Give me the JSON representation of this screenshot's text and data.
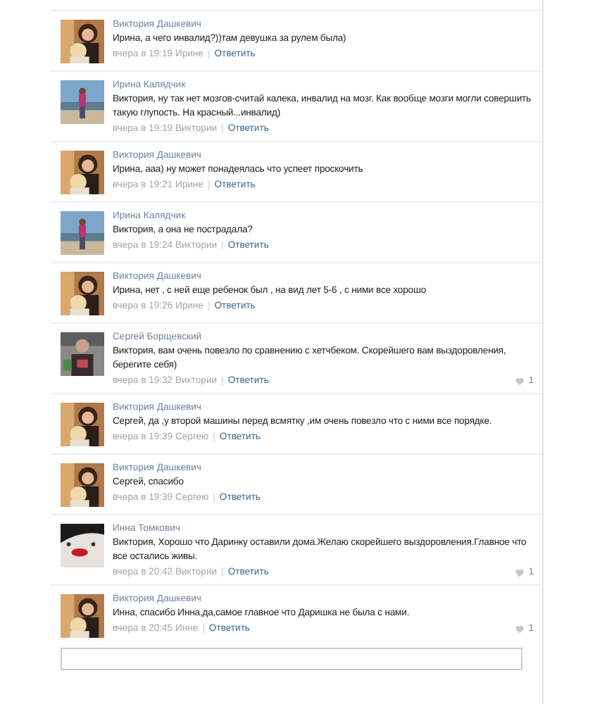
{
  "comments": [
    {
      "author": "Виктория Дашкевич",
      "text": "Ирина, а чего инвалид?))там девушка за рулем была)",
      "date": "вчера в 19:19 Ирине",
      "sep": "|",
      "reply": "Ответить"
    },
    {
      "author": "Ирина Калядчик",
      "text": "Виктория, ну так нет мозгов-считай калека, инвалид на мозг. Как вообще мозги могли совершить такую глупость. На красный...инвалид)",
      "date": "вчера в 19:19 Виктории",
      "sep": "|",
      "reply": "Ответить"
    },
    {
      "author": "Виктория Дашкевич",
      "text": "Ирина, ааа) ну может понадеялась что успеет проскочить",
      "date": "вчера в 19:21 Ирине",
      "sep": "|",
      "reply": "Ответить"
    },
    {
      "author": "Ирина Калядчик",
      "text": "Виктория, а она не пострадала?",
      "date": "вчера в 19:24 Виктории",
      "sep": "|",
      "reply": "Ответить"
    },
    {
      "author": "Виктория Дашкевич",
      "text": "Ирина, нет , с ней еще ребенок был , на вид лет 5-6 , с ними все хорошо",
      "date": "вчера в 19:26 Ирине",
      "sep": "|",
      "reply": "Ответить"
    },
    {
      "author": "Сергей Борщевский",
      "text": "Виктория, вам очень повезло по сравнению с хетчбеком. Скорейшего вам выздоровления, берегите себя)",
      "date": "вчера в 19:32 Виктории",
      "sep": "|",
      "reply": "Ответить",
      "likes": "1"
    },
    {
      "author": "Виктория Дашкевич",
      "text": "Сергей, да ,у второй машины перед всмятку ,им очень повезло что с ними все порядке.",
      "date": "вчера в 19:39 Сергею",
      "sep": "|",
      "reply": "Ответить"
    },
    {
      "author": "Виктория Дашкевич",
      "text": "Сергей, спасибо",
      "date": "вчера в 19:39 Сергею",
      "sep": "|",
      "reply": "Ответить"
    },
    {
      "author": "Инна Томкович",
      "text": "Виктория, Хорошо что Даринку оставили дома.Желаю скорейшего выздоровления.Главное что все остались живы.",
      "date": "вчера в 20:42 Виктории",
      "sep": "|",
      "reply": "Ответить",
      "likes": "1"
    },
    {
      "author": "Виктория Дашкевич",
      "text": "Инна, спасибо Инна,да,самое главное что Даришка не была с нами.",
      "date": "вчера в 20:45 Инне",
      "sep": "|",
      "reply": "Ответить",
      "likes": "1"
    }
  ]
}
